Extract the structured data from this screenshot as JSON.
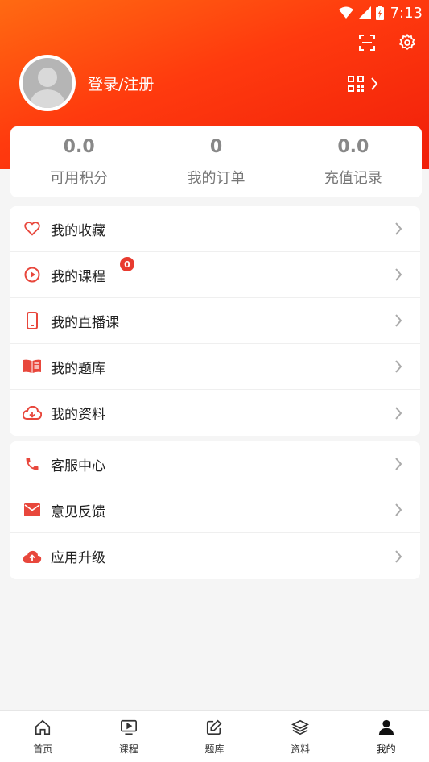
{
  "status": {
    "time": "7:13"
  },
  "user": {
    "login_text": "登录/注册"
  },
  "stats": [
    {
      "value": "0.0",
      "label": "可用积分"
    },
    {
      "value": "0",
      "label": "我的订单"
    },
    {
      "value": "0.0",
      "label": "充值记录"
    }
  ],
  "menu1": [
    {
      "label": "我的收藏",
      "icon": "heart-icon"
    },
    {
      "label": "我的课程",
      "icon": "play-circle-icon",
      "badge": "0"
    },
    {
      "label": "我的直播课",
      "icon": "phone-icon"
    },
    {
      "label": "我的题库",
      "icon": "book-icon"
    },
    {
      "label": "我的资料",
      "icon": "cloud-download-icon"
    }
  ],
  "menu2": [
    {
      "label": "客服中心",
      "icon": "phone-call-icon"
    },
    {
      "label": "意见反馈",
      "icon": "mail-icon"
    },
    {
      "label": "应用升级",
      "icon": "cloud-upload-icon"
    }
  ],
  "tabs": [
    {
      "label": "首页",
      "icon": "home-icon"
    },
    {
      "label": "课程",
      "icon": "tv-play-icon"
    },
    {
      "label": "题库",
      "icon": "edit-icon"
    },
    {
      "label": "资料",
      "icon": "layers-icon"
    },
    {
      "label": "我的",
      "icon": "person-icon",
      "active": true
    }
  ],
  "colors": {
    "accent": "#ff3a0e",
    "icon_red": "#e8473c"
  }
}
